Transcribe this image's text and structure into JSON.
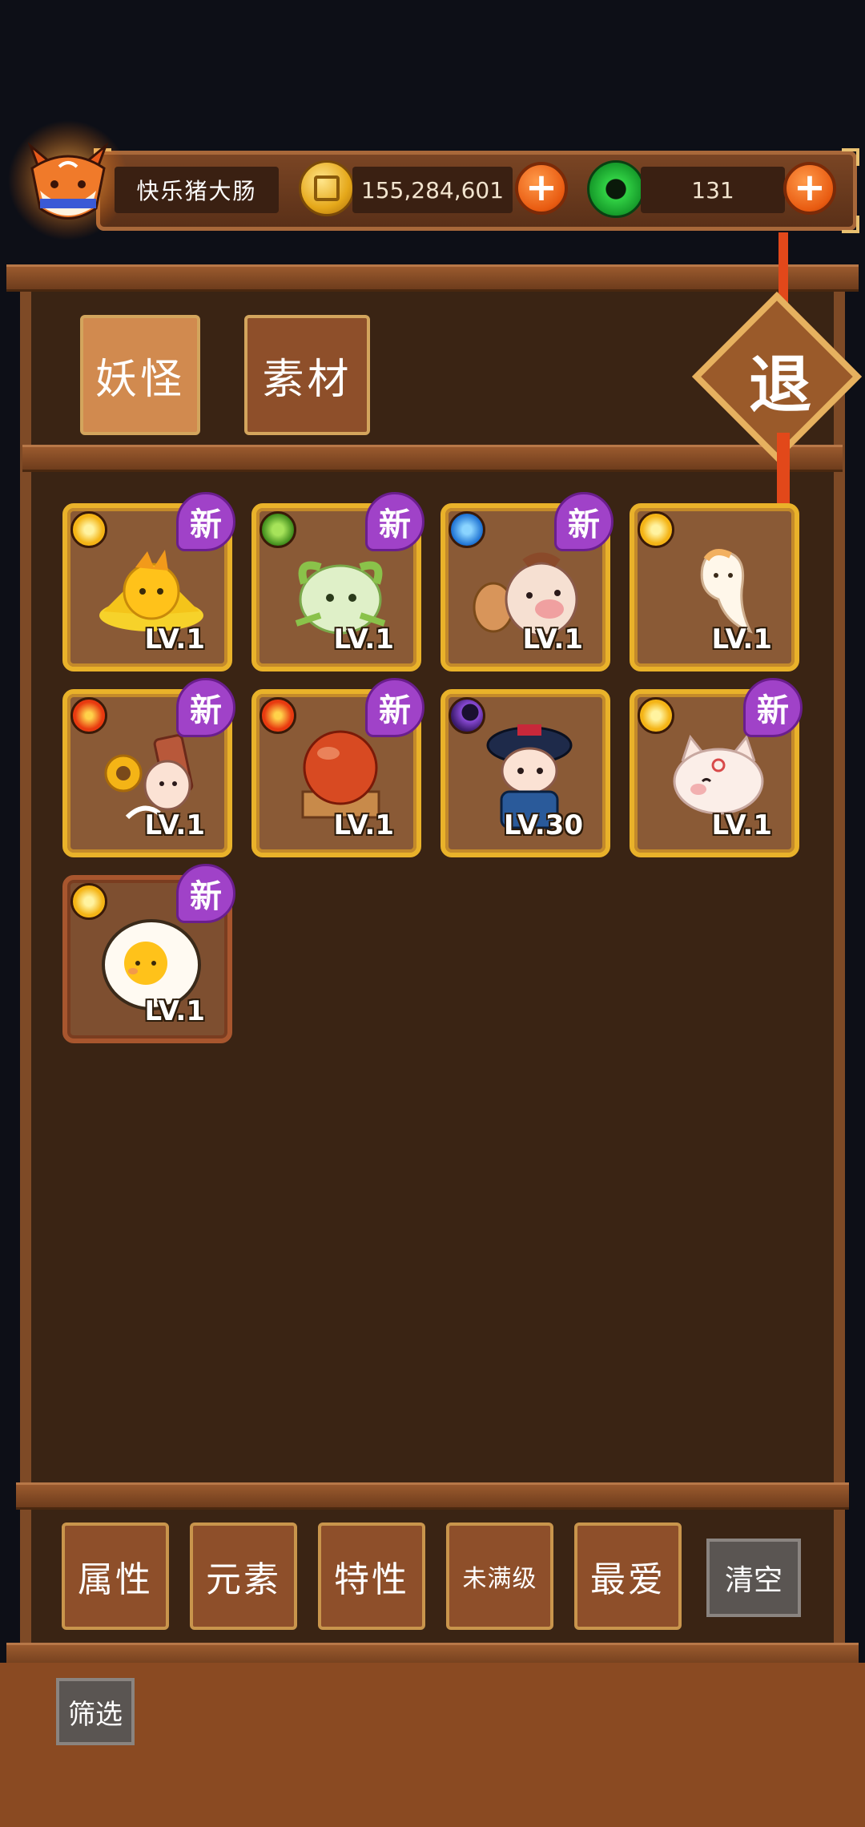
{
  "player": {
    "name": "快乐猪大肠"
  },
  "currency": {
    "coins": "155,284,601",
    "jade": "131",
    "add_label": "+"
  },
  "tabs": [
    {
      "label": "妖怪",
      "active": true
    },
    {
      "label": "素材",
      "active": false
    }
  ],
  "exit_label": "退",
  "new_badge": "新",
  "monsters": [
    {
      "element": "sun-icon",
      "level": "LV.1",
      "is_new": true,
      "art": "yellow-flower-creature"
    },
    {
      "element": "leaf-icon",
      "level": "LV.1",
      "is_new": true,
      "art": "green-cabbage-creature"
    },
    {
      "element": "water-icon",
      "level": "LV.1",
      "is_new": true,
      "art": "pig-with-fan"
    },
    {
      "element": "sun-icon",
      "level": "LV.1",
      "is_new": false,
      "art": "white-ghost-wisp"
    },
    {
      "element": "fire-icon",
      "level": "LV.1",
      "is_new": true,
      "art": "sunflower-scroll-girl"
    },
    {
      "element": "fire-icon",
      "level": "LV.1",
      "is_new": true,
      "art": "red-ball-on-stand"
    },
    {
      "element": "moon-icon",
      "level": "LV.30",
      "is_new": false,
      "art": "qing-official-boy"
    },
    {
      "element": "sun-icon",
      "level": "LV.1",
      "is_new": true,
      "art": "white-pig-spirit"
    },
    {
      "element": "sun-icon",
      "level": "LV.1",
      "is_new": true,
      "art": "fried-egg"
    }
  ],
  "filters": [
    {
      "label": "属性"
    },
    {
      "label": "元素"
    },
    {
      "label": "特性"
    },
    {
      "label": "未满级"
    },
    {
      "label": "最爱"
    }
  ],
  "clear_label": "清空",
  "filter_label": "筛选"
}
